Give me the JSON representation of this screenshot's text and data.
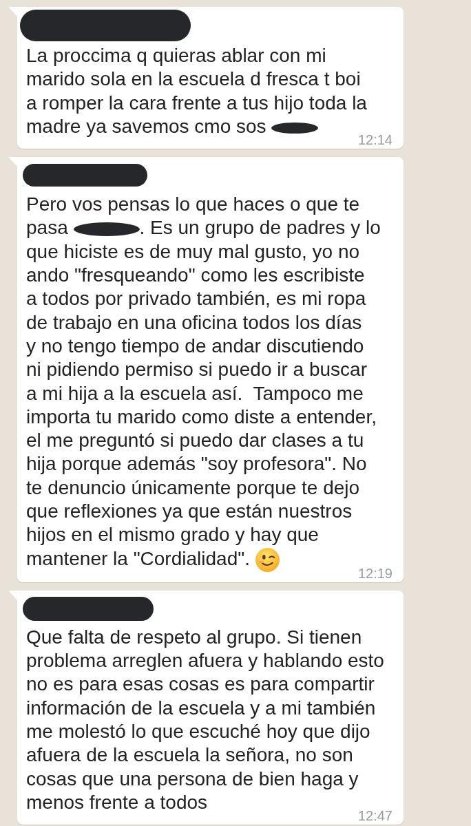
{
  "messages": [
    {
      "sender_redacted": true,
      "segments": [
        {
          "kind": "text",
          "text": "La proccima q quieras ablar con mi\nmarido sola en la escuela d fresca t boi\na romper la cara frente a tus hijo toda la\nmadre ya savemos cmo sos "
        },
        {
          "kind": "redaction"
        }
      ],
      "time": "12:14"
    },
    {
      "sender_redacted": true,
      "segments": [
        {
          "kind": "text",
          "text": "Pero vos pensas lo que haces o que te\npasa "
        },
        {
          "kind": "redaction"
        },
        {
          "kind": "text",
          "text": ". Es un grupo de padres y lo\nque hiciste es de muy mal gusto, yo no\nando \"fresqueando\" como les escribiste\na todos por privado también, es mi ropa\nde trabajo en una oficina todos los días\ny no tengo tiempo de andar discutiendo\nni pidiendo permiso si puedo ir a buscar\na mi hija a la escuela así.  Tampoco me\nimporta tu marido como diste a entender,\nel me preguntó si puedo dar clases a tu\nhija porque además \"soy profesora\". No\nte denuncio únicamente porque te dejo\nque reflexiones ya que están nuestros\nhijos en el mismo grado y hay que\nmantener la \"Cordialidad\". "
        },
        {
          "kind": "emoji"
        }
      ],
      "time": "12:19"
    },
    {
      "sender_redacted": true,
      "segments": [
        {
          "kind": "text",
          "text": "Que falta de respeto al grupo. Si tienen\nproblema arreglen afuera y hablando esto\nno es para esas cosas es para compartir\ninformación de la escuela y a mi también\nme molestó lo que escuché hoy que dijo\nafuera de la escuela la señora, no son\ncosas que una persona de bien haga y\nmenos frente a todos"
        }
      ],
      "time": "12:47"
    }
  ]
}
